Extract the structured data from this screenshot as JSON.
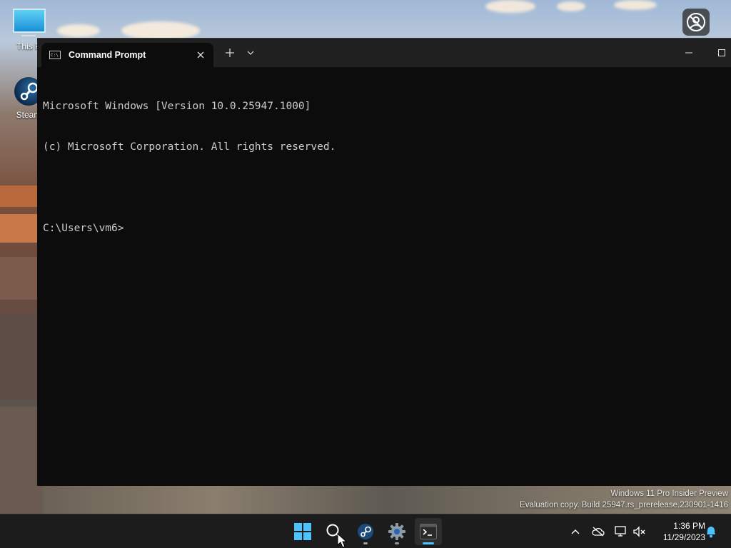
{
  "desktop": {
    "icons": [
      {
        "label": "This P",
        "icon": "this-pc-icon"
      },
      {
        "label": "Steam",
        "icon": "steam-icon"
      }
    ],
    "watermark": {
      "line1": "Windows 11 Pro Insider Preview",
      "line2": "Evaluation copy. Build 25947.rs_prerelease.230901-1416"
    }
  },
  "window": {
    "tab_title": "Command Prompt",
    "tab_icon": "cmd-icon",
    "console_lines": [
      "Microsoft Windows [Version 10.0.25947.1000]",
      "(c) Microsoft Corporation. All rights reserved.",
      "",
      "C:\\Users\\vm6>"
    ]
  },
  "taskbar": {
    "apps": [
      {
        "name": "start",
        "icon": "windows-logo-icon"
      },
      {
        "name": "search",
        "icon": "search-icon"
      },
      {
        "name": "steam",
        "icon": "steam-icon"
      },
      {
        "name": "settings",
        "icon": "gear-icon"
      },
      {
        "name": "terminal",
        "icon": "terminal-icon"
      }
    ],
    "clock": {
      "time": "1:36 PM",
      "date": "11/29/2023"
    }
  },
  "colors": {
    "accent": "#4cc2ff",
    "terminal_bg": "#0c0c0c",
    "titlebar_bg": "#202020",
    "taskbar_bg": "#1c1c1c",
    "console_text": "#cccccc"
  }
}
